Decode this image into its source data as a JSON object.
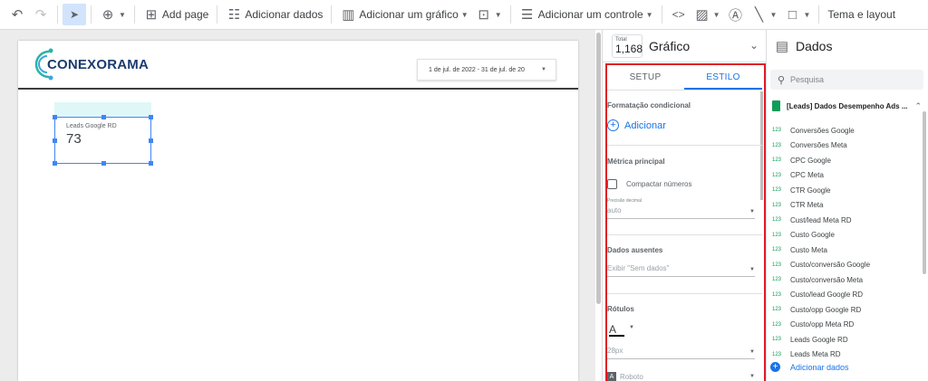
{
  "toolbar": {
    "add_page": "Add page",
    "add_data": "Adicionar dados",
    "add_chart": "Adicionar um gráfico",
    "add_control": "Adicionar um controle",
    "theme_layout": "Tema e layout"
  },
  "report": {
    "logo_text": "CONEXORAMA",
    "date_range": "1 de jul. de 2022 - 31 de jul. de 20",
    "scorecard": {
      "label": "Leads Google RD",
      "value": "73"
    }
  },
  "properties": {
    "total_label": "Total",
    "total_value": "1,168",
    "title": "Gráfico",
    "tabs": [
      "SETUP",
      "ESTILO"
    ],
    "sections": {
      "conditional_formatting": "Formatação condicional",
      "add": "Adicionar",
      "main_metric": "Métrica principal",
      "compact_numbers": "Compactar números",
      "decimal_precision": "Precisão decimal",
      "decimal_value": "auto",
      "missing_data": "Dados ausentes",
      "missing_value": "Exibir \"Sem dados\"",
      "labels": "Rótulos",
      "font_color_letter": "A",
      "font_size": "28px",
      "font_family": "Roboto"
    }
  },
  "data_panel": {
    "title": "Dados",
    "search_placeholder": "Pesquisa",
    "source": "[Leads] Dados Desempenho Ads ...",
    "number_tag": "123",
    "fields": [
      "Conversões Google",
      "Conversões Meta",
      "CPC Google",
      "CPC Meta",
      "CTR Google",
      "CTR Meta",
      "Cust/lead Meta RD",
      "Custo Google",
      "Custo Meta",
      "Custo/conversão Google",
      "Custo/conversão Meta",
      "Custo/lead Google RD",
      "Custo/opp Google RD",
      "Custo/opp Meta RD",
      "Leads Google RD",
      "Leads Meta RD"
    ],
    "add_data": "Adicionar dados"
  },
  "colors": {
    "accent": "#1a73e8",
    "highlight": "#e01b24",
    "sheet_green": "#0f9d58"
  }
}
